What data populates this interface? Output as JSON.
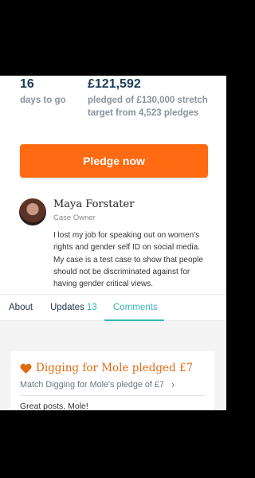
{
  "stats": {
    "days_number": "16",
    "days_label": "days to go",
    "amount": "£121,592",
    "amount_line1": "pledged of £130,000 stretch",
    "amount_line2": "target from 4,523 pledges"
  },
  "pledge_button": "Pledge now",
  "owner": {
    "name": "Maya Forstater",
    "role": "Case Owner",
    "description": "I lost my job for speaking out on women's rights and gender self ID on social media. My case is a test case to show that people should not be discriminated against for having gender critical views."
  },
  "tabs": {
    "about": "About",
    "updates": "Updates",
    "updates_count": "13",
    "comments": "Comments"
  },
  "comment_card": {
    "title": "Digging for Mole pledged £7",
    "match": "Match Digging for Mole's pledge of £7",
    "icon": "heart-icon",
    "comment": "Great posts, Mole!"
  },
  "colors": {
    "accent_orange": "#ff6a12",
    "teal": "#35b7b0",
    "navy": "#1f3a5a"
  }
}
